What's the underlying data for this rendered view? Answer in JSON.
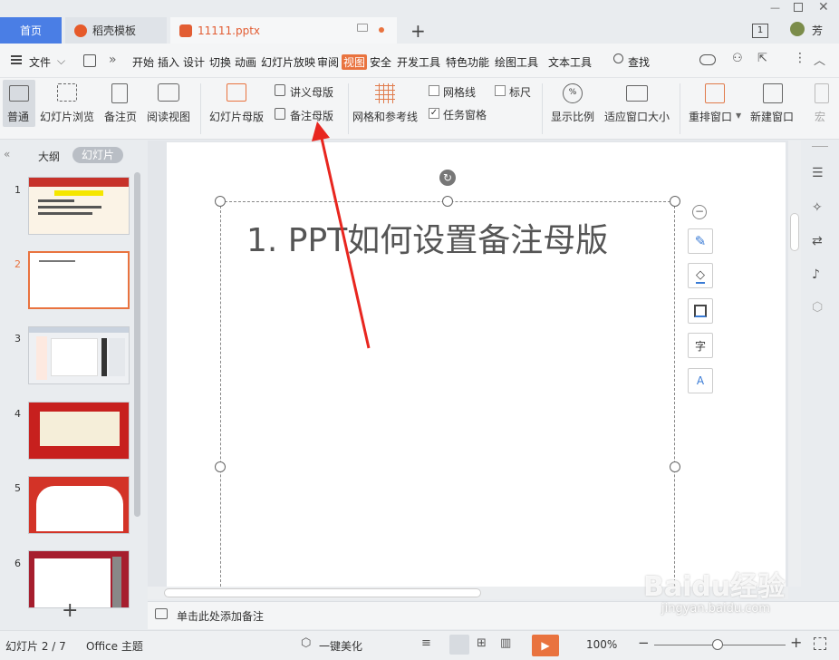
{
  "tabs": {
    "home": "首页",
    "daoke": "稻壳模板",
    "file": "11111.pptx",
    "new_tab": "+"
  },
  "window": {
    "badge": "1",
    "user": "芳"
  },
  "menubar": {
    "file": "文件",
    "items": [
      "开始",
      "插入",
      "设计",
      "切换",
      "动画",
      "幻灯片放映",
      "审阅",
      "视图",
      "安全",
      "开发工具",
      "特色功能",
      "绘图工具",
      "文本工具"
    ],
    "active": "视图",
    "search": "查找"
  },
  "ribbon": {
    "normal": "普通",
    "slide_browse": "幻灯片浏览",
    "notes_page": "备注页",
    "reading_view": "阅读视图",
    "slide_master": "幻灯片母版",
    "handout_master": "讲义母版",
    "notes_master": "备注母版",
    "grid_guides": "网格和参考线",
    "gridlines": "网格线",
    "ruler": "标尺",
    "task_pane": "任务窗格",
    "zoom": "显示比例",
    "fit_window": "适应窗口大小",
    "arrange_windows": "重排窗口",
    "new_window": "新建窗口",
    "macro": "宏"
  },
  "panel": {
    "outline": "大纲",
    "slides": "幻灯片",
    "numbers": [
      "1",
      "2",
      "3",
      "4",
      "5",
      "6"
    ]
  },
  "slide": {
    "title": "1.  PPT如何设置备注母版"
  },
  "notes": {
    "placeholder": "单击此处添加备注"
  },
  "status": {
    "slide_count": "幻灯片 2 / 7",
    "theme": "Office 主题",
    "beautify": "一键美化",
    "zoom": "100%"
  },
  "watermark": {
    "brand": "Baidu经验",
    "url": "jingyan.baidu.com"
  },
  "colors": {
    "accent": "#e9733f",
    "home_tab": "#4a7ee5",
    "arrow": "#e8261f"
  }
}
